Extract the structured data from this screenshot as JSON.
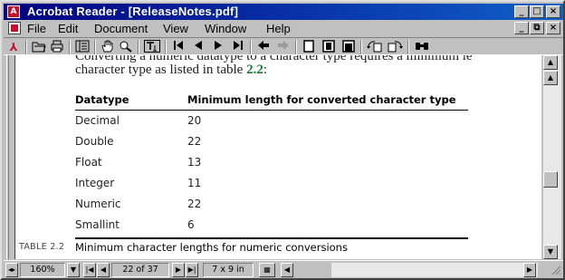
{
  "titlebar": {
    "title": "Acrobat Reader - [ReleaseNotes.pdf]",
    "minimize": "_",
    "maximize": "□",
    "close": "×"
  },
  "menubar": {
    "items": [
      "File",
      "Edit",
      "Document",
      "View",
      "Window",
      "Help"
    ],
    "doc_minimize": "_",
    "doc_restore": "⧉",
    "doc_close": "×"
  },
  "toolbar": {
    "buttons": [
      {
        "icon": "acrobat-icon",
        "glyph": "⅄"
      },
      {
        "icon": "open-icon",
        "glyph": "📂"
      },
      {
        "icon": "print-icon",
        "glyph": "⎙"
      },
      {
        "icon": "show-hide-navigation-icon",
        "glyph": "▤"
      },
      {
        "icon": "hand-tool-icon",
        "glyph": "✋"
      },
      {
        "icon": "zoom-tool-icon",
        "glyph": "🔍"
      },
      {
        "icon": "text-select-tool-icon",
        "glyph": "T"
      },
      {
        "icon": "first-page-icon",
        "glyph": "|◀"
      },
      {
        "icon": "previous-page-icon",
        "glyph": "◀"
      },
      {
        "icon": "next-page-icon",
        "glyph": "▶"
      },
      {
        "icon": "last-page-icon",
        "glyph": "▶|"
      },
      {
        "icon": "go-back-icon",
        "glyph": "◆"
      },
      {
        "icon": "go-forward-icon",
        "glyph": "◆"
      },
      {
        "icon": "actual-size-icon",
        "glyph": "▯"
      },
      {
        "icon": "fit-in-window-icon",
        "glyph": "▣"
      },
      {
        "icon": "fit-width-icon",
        "glyph": "▤"
      },
      {
        "icon": "rotate-left-icon",
        "glyph": "↶"
      },
      {
        "icon": "rotate-right-icon",
        "glyph": "↷"
      },
      {
        "icon": "find-icon",
        "glyph": "🔭"
      }
    ]
  },
  "document": {
    "paragraph_line1": "Converting a numeric datatype to a character type requires a minimum le",
    "paragraph_line2_pre": "character type as listed in table ",
    "paragraph_ref": "2.2",
    "paragraph_line2_post": ":",
    "table": {
      "headers": [
        "Datatype",
        "Minimum length for converted character type"
      ],
      "rows": [
        [
          "Decimal",
          "20"
        ],
        [
          "Double",
          "22"
        ],
        [
          "Float",
          "13"
        ],
        [
          "Integer",
          "11"
        ],
        [
          "Numeric",
          "22"
        ],
        [
          "Smallint",
          "6"
        ]
      ]
    },
    "caption_tag": "TABLE 2.2",
    "caption_text": "Minimum character lengths for numeric conversions"
  },
  "statusbar": {
    "zoom": "160%",
    "page": "22 of 37",
    "page_size": "7 x 9 in"
  }
}
